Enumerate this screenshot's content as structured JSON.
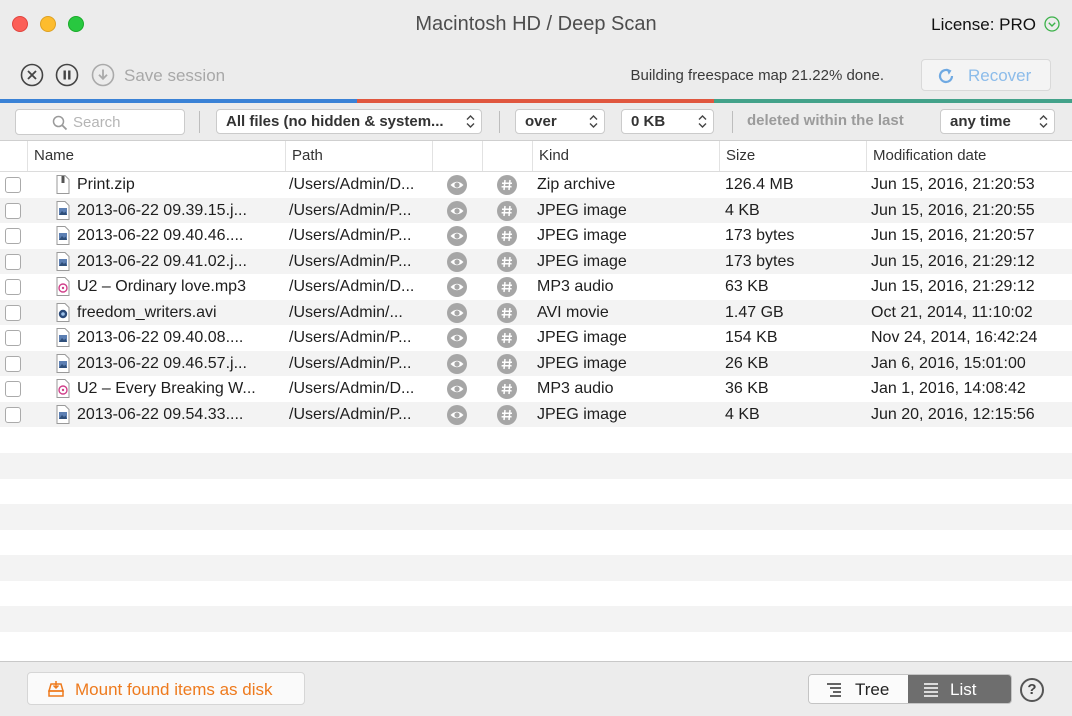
{
  "window": {
    "title": "Macintosh HD / Deep Scan",
    "license": "License: PRO"
  },
  "toolbar": {
    "save_label": "Save session",
    "status": "Building freespace map 21.22% done.",
    "recover_label": "Recover",
    "accent_color": "#8cbcea"
  },
  "progress_colors": [
    "#3a82d6",
    "#e0573f",
    "#43a28a"
  ],
  "filters": {
    "search_placeholder": "Search",
    "file_filter": "All files (no hidden & system...",
    "size_comparator": "over",
    "size_value": "0 KB",
    "deleted_label": "deleted within the last",
    "time_value": "any time"
  },
  "columns": {
    "name": "Name",
    "path": "Path",
    "kind": "Kind",
    "size": "Size",
    "modified": "Modification date"
  },
  "rows": [
    {
      "name": "Print.zip",
      "path": "/Users/Admin/D...",
      "kind": "Zip archive",
      "size": "126.4 MB",
      "modified": "Jun 15, 2016, 21:20:53",
      "icon": "zip-file-icon"
    },
    {
      "name": "2013-06-22 09.39.15.j...",
      "path": "/Users/Admin/P...",
      "kind": "JPEG image",
      "size": "4 KB",
      "modified": "Jun 15, 2016, 21:20:55",
      "icon": "jpeg-file-icon"
    },
    {
      "name": "2013-06-22 09.40.46....",
      "path": "/Users/Admin/P...",
      "kind": "JPEG image",
      "size": "173 bytes",
      "modified": "Jun 15, 2016, 21:20:57",
      "icon": "jpeg-file-icon"
    },
    {
      "name": "2013-06-22 09.41.02.j...",
      "path": "/Users/Admin/P...",
      "kind": "JPEG image",
      "size": "173 bytes",
      "modified": "Jun 15, 2016, 21:29:12",
      "icon": "jpeg-file-icon"
    },
    {
      "name": "U2 – Ordinary love.mp3",
      "path": "/Users/Admin/D...",
      "kind": "MP3 audio",
      "size": "63 KB",
      "modified": "Jun 15, 2016, 21:29:12",
      "icon": "mp3-file-icon"
    },
    {
      "name": "freedom_writers.avi",
      "path": "/Users/Admin/...",
      "kind": "AVI movie",
      "size": "1.47 GB",
      "modified": "Oct 21, 2014, 11:10:02",
      "icon": "avi-file-icon"
    },
    {
      "name": "2013-06-22 09.40.08....",
      "path": "/Users/Admin/P...",
      "kind": "JPEG image",
      "size": "154 KB",
      "modified": "Nov 24, 2014, 16:42:24",
      "icon": "jpeg-file-icon"
    },
    {
      "name": "2013-06-22 09.46.57.j...",
      "path": "/Users/Admin/P...",
      "kind": "JPEG image",
      "size": "26 KB",
      "modified": "Jan 6, 2016, 15:01:00",
      "icon": "jpeg-file-icon"
    },
    {
      "name": "U2 – Every Breaking W...",
      "path": "/Users/Admin/D...",
      "kind": "MP3 audio",
      "size": "36 KB",
      "modified": "Jan 1, 2016, 14:08:42",
      "icon": "mp3-file-icon"
    },
    {
      "name": "2013-06-22 09.54.33....",
      "path": "/Users/Admin/P...",
      "kind": "JPEG image",
      "size": "4 KB",
      "modified": "Jun 20, 2016, 12:15:56",
      "icon": "jpeg-file-icon"
    }
  ],
  "bottom": {
    "mount_label": "Mount found items as disk",
    "mount_color": "#ee7a1d",
    "tree_label": "Tree",
    "list_label": "List",
    "help_label": "?"
  }
}
